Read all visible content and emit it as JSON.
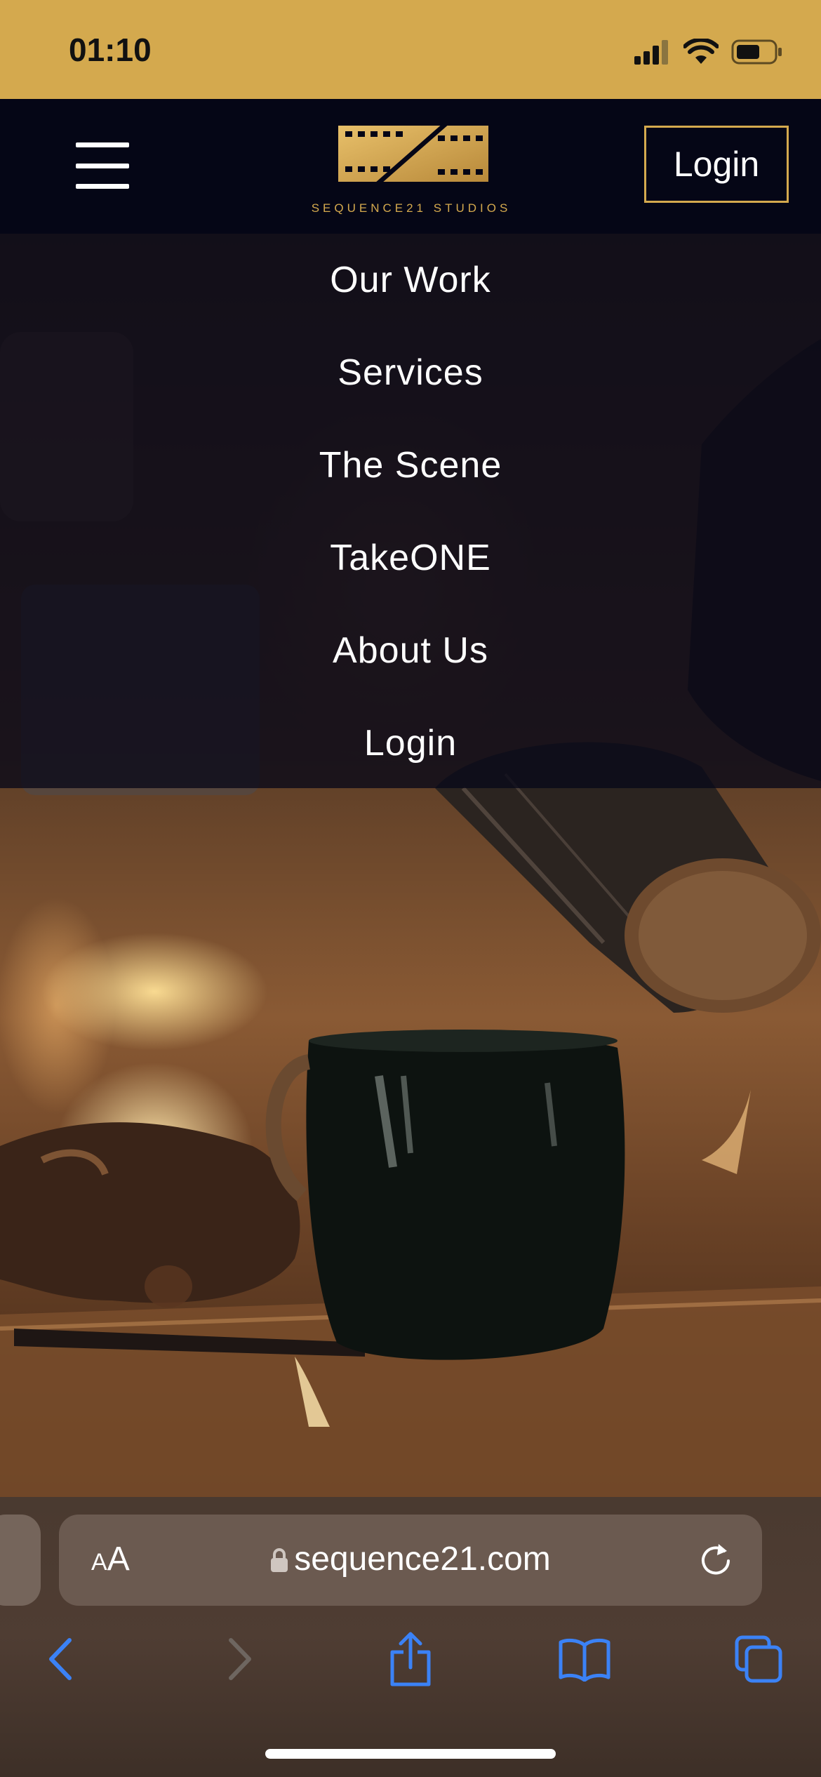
{
  "status_bar": {
    "time": "01:10",
    "icons": [
      "cellular-signal-icon",
      "wifi-icon",
      "battery-icon"
    ]
  },
  "header": {
    "brand": "SEQUENCE21 STUDIOS",
    "login_label": "Login"
  },
  "menu": {
    "items": [
      {
        "label": "Our Work"
      },
      {
        "label": "Services"
      },
      {
        "label": "The Scene"
      },
      {
        "label": "TakeONE"
      },
      {
        "label": "About Us"
      },
      {
        "label": "Login"
      }
    ]
  },
  "browser": {
    "text_size_small": "A",
    "text_size_large": "A",
    "url": "sequence21.com"
  },
  "colors": {
    "accent_gold": "#d4a94e",
    "header_bg": "#050616",
    "toolbar_blue": "#3b82f6"
  }
}
